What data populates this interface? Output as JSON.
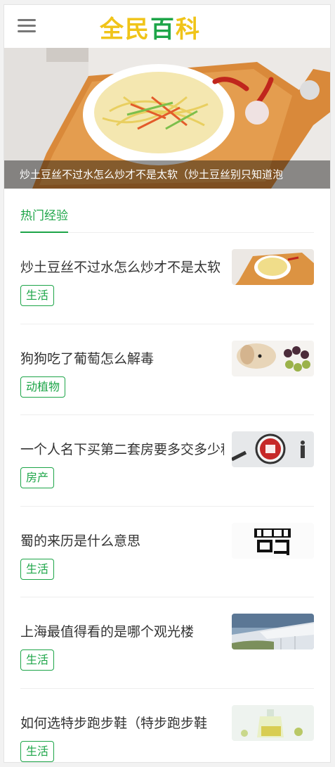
{
  "header": {
    "logo_chars": [
      "全",
      "民",
      "百",
      "科"
    ],
    "logo_colors": [
      "#f0c419",
      "#f0c419",
      "#1da548",
      "#f0c419"
    ]
  },
  "banner": {
    "caption": "炒土豆丝不过水怎么炒才不是太软（炒土豆丝别只知道泡"
  },
  "tabs": {
    "active": "热门经验"
  },
  "articles": [
    {
      "title": "炒土豆丝不过水怎么炒才不是太软",
      "tag": "生活",
      "thumb": "potato-dish-thumbnail"
    },
    {
      "title": "狗狗吃了葡萄怎么解毒",
      "tag": "动植物",
      "thumb": "dog-grapes-thumbnail"
    },
    {
      "title": "一个人名下买第二套房要多交多少税",
      "tag": "房产",
      "thumb": "tax-magnifier-thumbnail"
    },
    {
      "title": "蜀的来历是什么意思",
      "tag": "生活",
      "thumb": "shu-character-thumbnail"
    },
    {
      "title": "上海最值得看的是哪个观光楼",
      "tag": "生活",
      "thumb": "building-thumbnail"
    },
    {
      "title": "如何选特步跑步鞋（特步跑步鞋",
      "tag": "生活",
      "thumb": "oil-bottle-thumbnail"
    }
  ],
  "colors": {
    "accent": "#1da548",
    "logo_yellow": "#f0c419"
  }
}
